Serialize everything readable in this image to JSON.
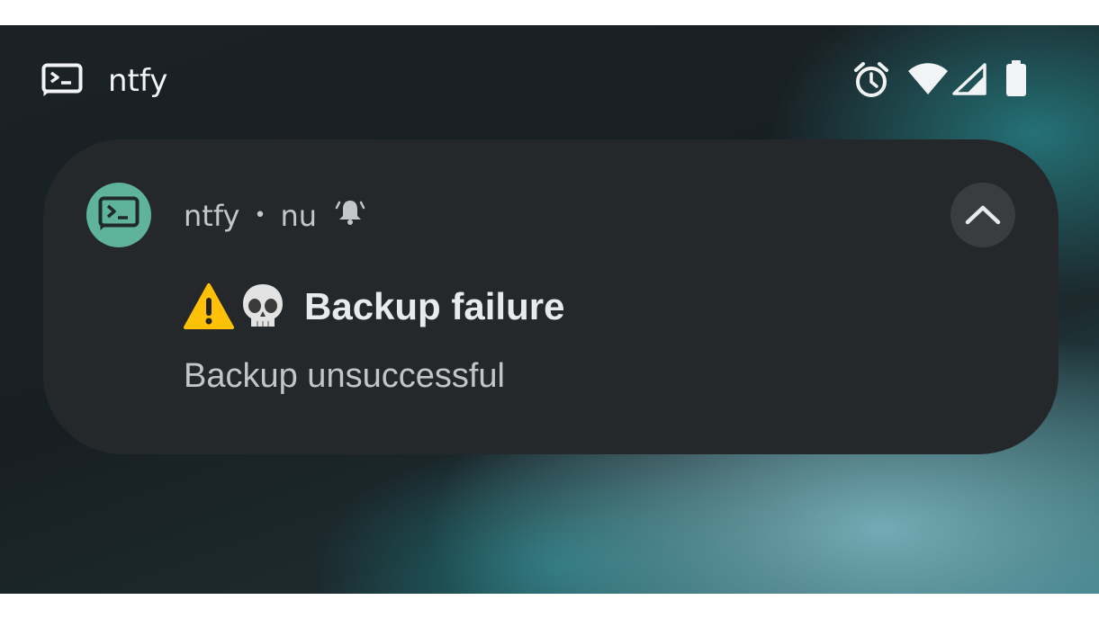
{
  "status_bar": {
    "app_name": "ntfy",
    "icons": [
      "terminal-icon",
      "alarm-icon",
      "wifi-icon",
      "signal-icon",
      "battery-icon"
    ]
  },
  "notification": {
    "app_name": "ntfy",
    "separator": "•",
    "topic": "nu",
    "title_emojis": [
      "warning-emoji",
      "skull-emoji"
    ],
    "title": "Backup failure",
    "body": "Backup unsuccessful",
    "avatar_color": "#5fb39a"
  }
}
